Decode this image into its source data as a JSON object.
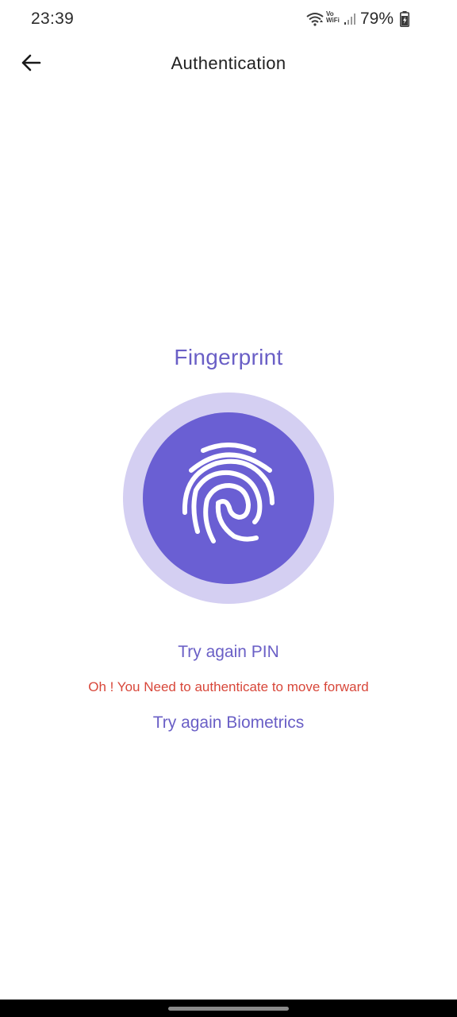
{
  "status_bar": {
    "time": "23:39",
    "battery_percent": "79%",
    "wifi_calling": "Vo\nWiFi",
    "icons": [
      "wifi-icon",
      "vowifi-icon",
      "signal-icon",
      "battery-charging-icon"
    ]
  },
  "app_bar": {
    "title": "Authentication",
    "back_icon": "arrow-back-icon"
  },
  "auth": {
    "method_label": "Fingerprint",
    "icon": "fingerprint-icon",
    "try_pin_label": "Try again PIN",
    "error_message": "Oh ! You Need to authenticate to move forward",
    "try_biometrics_label": "Try again Biometrics"
  },
  "colors": {
    "accent": "#6a5fc6",
    "circle_inner": "#6a5fd3",
    "circle_outer": "#d4cff2",
    "error": "#d8473a"
  }
}
